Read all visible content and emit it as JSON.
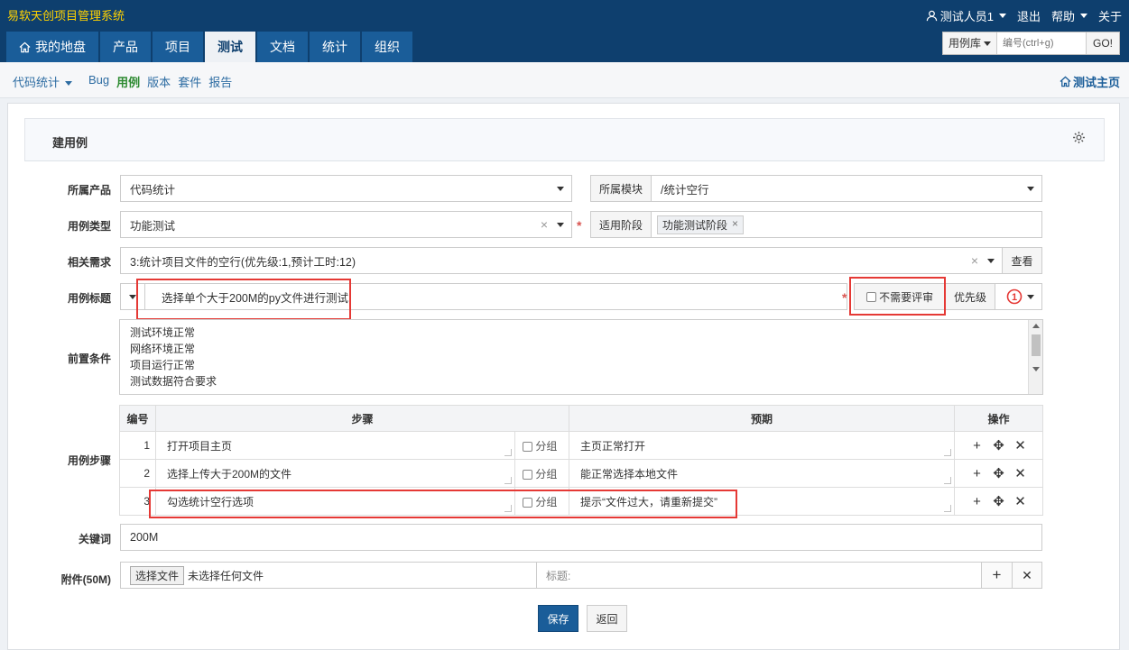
{
  "app_title": "易软天创项目管理系统",
  "topnav": {
    "user": "测试人员1",
    "logout": "退出",
    "help": "帮助",
    "about": "关于"
  },
  "mainnav": [
    "我的地盘",
    "产品",
    "项目",
    "测试",
    "文档",
    "统计",
    "组织"
  ],
  "search": {
    "type": "用例库",
    "placeholder": "编号(ctrl+g)",
    "go": "GO!"
  },
  "subnav": {
    "product": "代码统计",
    "items": [
      "Bug",
      "用例",
      "版本",
      "套件",
      "报告"
    ],
    "home": "测试主页"
  },
  "form": {
    "title": "建用例",
    "product_label": "所属产品",
    "product_value": "代码统计",
    "module_label": "所属模块",
    "module_value": "/统计空行",
    "type_label": "用例类型",
    "type_value": "功能测试",
    "stage_label": "适用阶段",
    "stage_tag": "功能测试阶段",
    "story_label": "相关需求",
    "story_value": "3:统计项目文件的空行(优先级:1,预计工时:12)",
    "view_btn": "查看",
    "case_title_label": "用例标题",
    "case_title_value": "选择单个大于200M的py文件进行测试",
    "no_review": "不需要评审",
    "priority_label": "优先级",
    "priority_value": "1",
    "pre_label": "前置条件",
    "pre_lines": [
      "测试环境正常",
      "网络环境正常",
      "项目运行正常",
      "测试数据符合要求"
    ],
    "steps_label": "用例步骤",
    "steps_headers": {
      "num": "编号",
      "step": "步骤",
      "expect": "预期",
      "ops": "操作"
    },
    "group_label": "分组",
    "steps": [
      {
        "num": "1",
        "step": "打开项目主页",
        "expect": "主页正常打开"
      },
      {
        "num": "2",
        "step": "选择上传大于200M的文件",
        "expect": "能正常选择本地文件"
      },
      {
        "num": "3",
        "step": "勾选统计空行选项",
        "expect": "提示“文件过大，请重新提交”"
      }
    ],
    "keywords_label": "关键词",
    "keywords_value": "200M",
    "attach_label": "附件(50M)",
    "choose_file": "选择文件",
    "no_file": "未选择任何文件",
    "attach_title": "标题:",
    "save": "保存",
    "back": "返回"
  },
  "colors": {
    "header": "#0e3f6e",
    "brand": "#ffd200",
    "accent": "#1a5d99",
    "highlight": "#e53935"
  }
}
